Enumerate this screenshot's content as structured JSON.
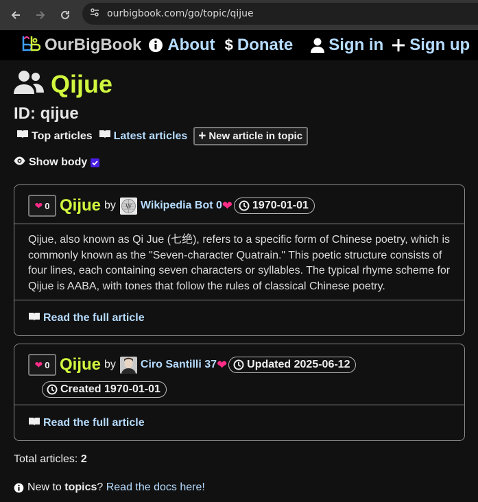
{
  "browser": {
    "url": "ourbigbook.com/go/topic/qijue"
  },
  "header": {
    "brand": "OurBigBook",
    "about": "About",
    "donate": "Donate",
    "sign_in": "Sign in",
    "sign_up": "Sign up"
  },
  "page": {
    "title": "Qijue",
    "id_label": "ID: qijue",
    "tabs": {
      "top": "Top articles",
      "latest": "Latest articles",
      "new": "New article in topic"
    },
    "show_body": "Show body"
  },
  "articles": [
    {
      "likes": "0",
      "title": "Qijue",
      "by": "by",
      "author": "Wikipedia Bot",
      "author_score": "0",
      "date": "1970-01-01",
      "body": "Qijue, also known as Qi Jue (七绝), refers to a specific form of Chinese poetry, which is commonly known as the \"Seven-character Quatrain.\" This poetic structure consists of four lines, each containing seven characters or syllables. The typical rhyme scheme for Qijue is AABA, with tones that follow the rules of classical Chinese poetry.",
      "read_more": "Read the full article"
    },
    {
      "likes": "0",
      "title": "Qijue",
      "by": "by",
      "author": "Ciro Santilli",
      "author_score": "37",
      "updated": "Updated 2025-06-12",
      "created": "Created 1970-01-01",
      "read_more": "Read the full article"
    }
  ],
  "footer": {
    "total_label": "Total articles: ",
    "total_value": "2",
    "docs_prefix": "New to ",
    "docs_bold": "topics",
    "docs_q": "? ",
    "docs_link": "Read the docs here!"
  },
  "colors": {
    "title_yellow": "#d1f73e",
    "link_blue": "#b6dcff",
    "heart_pink": "#ff2d87"
  }
}
